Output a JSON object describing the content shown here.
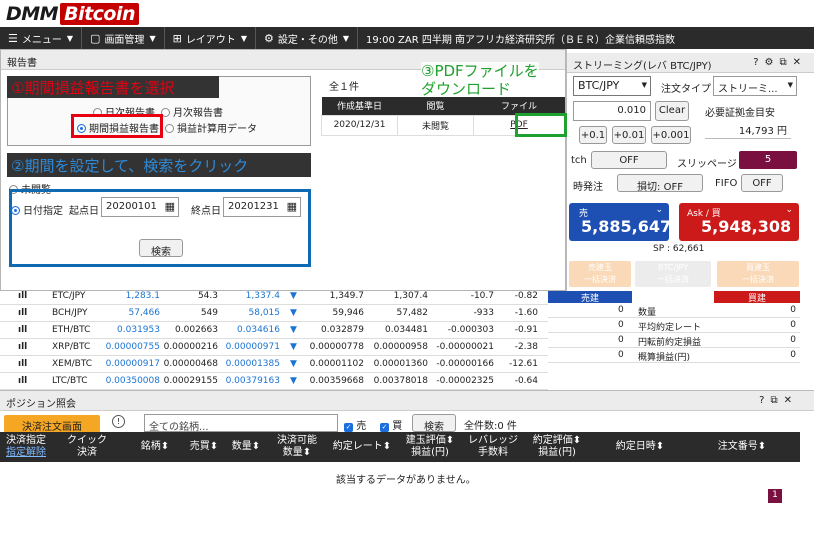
{
  "logo": {
    "part1": "DMM",
    "part2": "Bitcoin"
  },
  "menu": {
    "items": [
      "メニュー",
      "画面管理",
      "レイアウト",
      "設定・その他"
    ],
    "ticker": "19:00  ZAR  四半期 南アフリカ経済研究所（ＢＥＲ）企業信頼感指数"
  },
  "report": {
    "title": "報告書",
    "annotation1": "①期間損益報告書を選択",
    "annotation2": "②期間を設定して、検索をクリック",
    "annotation3": "③PDFファイルを\nダウンロード",
    "radio_daily": "日次報告書",
    "radio_monthly": "月次報告書",
    "radio_period": "期間損益報告書",
    "radio_calc": "損益計算用データ",
    "radio_unread": "未閲覧",
    "radio_date": "日付指定",
    "start_label": "起点日",
    "start_value": "20200101",
    "end_label": "終点日",
    "end_value": "20201231",
    "search_button": "検索",
    "count": "全１件",
    "table": {
      "headers": [
        "作成基準日",
        "閲覧",
        "ファイル"
      ],
      "rows": [
        {
          "date": "2020/12/31",
          "status": "未閲覧",
          "file": "PDF"
        }
      ]
    }
  },
  "trade": {
    "title": "ストリーミング(レバ BTC/JPY)",
    "pair": "BTC/JPY",
    "order_type_label": "注文タイプ",
    "order_type_value": "ストリーミ...",
    "qty": "0.010",
    "clear": "Clear",
    "margin_label": "必要証拠金目安",
    "margin_value": "14,793 円",
    "inc1": "+0.1",
    "inc2": "+0.01",
    "inc3": "+0.001",
    "switch_label": "tch",
    "switch_value": "OFF",
    "slippage_label": "スリッページ",
    "slippage_value": "5",
    "simul_label": "時発注",
    "simul_value": "損切: OFF",
    "fifo_label": "FIFO",
    "fifo_value": "OFF",
    "bid_label": "売",
    "bid_price": "5,885,647",
    "ask_label": "Ask / 買",
    "ask_price": "5,948,308",
    "spread": "SP : 62,661",
    "sell_pos": "売建玉\n一括決済",
    "pair_pos": "BTC/JPY\n一括決済",
    "buy_pos": "買建玉\n一括決済",
    "sum_sell": "売建",
    "sum_buy": "買建",
    "summary": [
      {
        "label": "数量",
        "sell": "0",
        "buy": "0"
      },
      {
        "label": "平均約定レート",
        "sell": "0",
        "buy": "0"
      },
      {
        "label": "円転前約定損益",
        "sell": "0",
        "buy": "0"
      },
      {
        "label": "概算損益(円)",
        "sell": "0",
        "buy": "0"
      }
    ]
  },
  "rates": [
    {
      "pair": "ETC/JPY",
      "a": "1,283.1",
      "b": "54.3",
      "c": "1,337.4",
      "d": "1,349.7",
      "e": "1,307.4",
      "f": "-10.7",
      "g": "-0.82"
    },
    {
      "pair": "BCH/JPY",
      "a": "57,466",
      "b": "549",
      "c": "58,015",
      "d": "59,946",
      "e": "57,482",
      "f": "-933",
      "g": "-1.60"
    },
    {
      "pair": "ETH/BTC",
      "a": "0.031953",
      "b": "0.002663",
      "c": "0.034616",
      "d": "0.032879",
      "e": "0.034481",
      "f": "-0.000303",
      "g": "-0.91"
    },
    {
      "pair": "XRP/BTC",
      "a": "0.00000755",
      "b": "0.00000216",
      "c": "0.00000971",
      "d": "0.00000778",
      "e": "0.00000958",
      "f": "-0.00000021",
      "g": "-2.38"
    },
    {
      "pair": "XEM/BTC",
      "a": "0.00000917",
      "b": "0.00000468",
      "c": "0.00001385",
      "d": "0.00001102",
      "e": "0.00001360",
      "f": "-0.00000166",
      "g": "-12.61"
    },
    {
      "pair": "LTC/BTC",
      "a": "0.00350008",
      "b": "0.00029155",
      "c": "0.00379163",
      "d": "0.00359668",
      "e": "0.00378018",
      "f": "-0.00002325",
      "g": "-0.64"
    }
  ],
  "positions": {
    "title": "ポジション照会",
    "order_screen": "決済注文画面",
    "pair_placeholder": "全ての銘柄...",
    "sell_check": "売",
    "buy_check": "買",
    "search": "検索",
    "total": "全件数:0 件",
    "headers": {
      "settle1": "決済指定",
      "settle2": "指定解除",
      "quick1": "クイック",
      "quick2": "決済",
      "symbol": "銘柄",
      "side": "売買",
      "qty": "数量",
      "avail1": "決済可能",
      "avail2": "数量",
      "rate": "約定レート",
      "eval1": "建玉評価",
      "eval2": "損益(円)",
      "lev1": "レバレッジ",
      "lev2": "手数料",
      "ceval1": "約定評価",
      "ceval2": "損益(円)",
      "time": "約定日時",
      "id": "注文番号"
    },
    "empty": "該当するデータがありません。",
    "page": "1"
  },
  "colors": {
    "accent_red": "#e60012",
    "bid_blue": "#1e50b4",
    "ask_red": "#cc1a1a",
    "annot_green": "#1fa12f",
    "annot_blue": "#0f6ab4"
  }
}
